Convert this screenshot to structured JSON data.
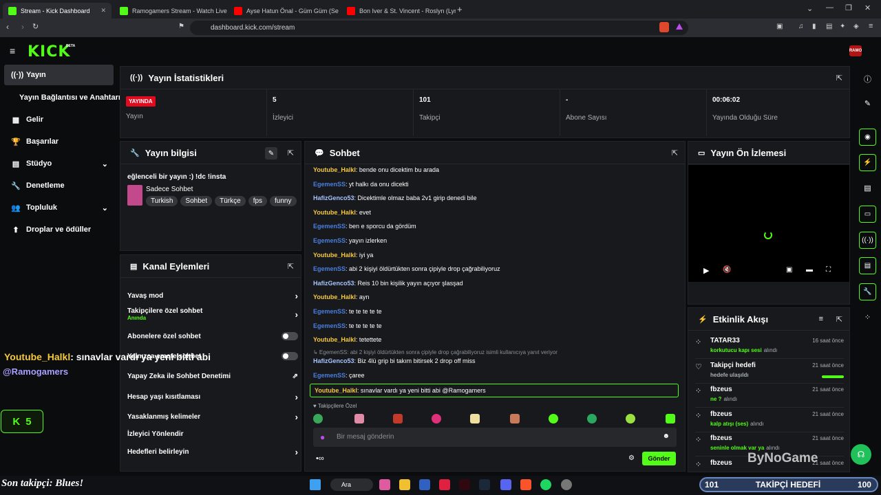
{
  "browser": {
    "tabs": [
      {
        "label": "Stream - Kick Dashboard",
        "color": "#53fc18"
      },
      {
        "label": "Ramogamers Stream - Watch Live on",
        "color": "#53fc18"
      },
      {
        "label": "Ayse Hatun Önal - Güm Güm (Se",
        "color": "#ff0000"
      },
      {
        "label": "Bon Iver & St. Vincent - Roslyn (Lyrics",
        "color": "#ff0000"
      }
    ],
    "url": "dashboard.kick.com/stream",
    "new_tab": "+"
  },
  "app": {
    "logo": "KICK",
    "logo_sup": "BETA",
    "brand": "RAMO"
  },
  "sidebar": {
    "items": [
      {
        "label": "Yayın",
        "icon": "((·))",
        "active": true
      },
      {
        "label": "Yayın Bağlantısı ve Anahtarı",
        "icon": "",
        "active": false
      },
      {
        "label": "Gelir",
        "icon": "▦",
        "active": false
      },
      {
        "label": "Başarılar",
        "icon": "🏆",
        "active": false
      },
      {
        "label": "Stüdyo",
        "icon": "▤",
        "active": false,
        "chevron": "⌄"
      },
      {
        "label": "Denetleme",
        "icon": "🔧",
        "active": false
      },
      {
        "label": "Topluluk",
        "icon": "👥",
        "active": false,
        "chevron": "⌄"
      },
      {
        "label": "Droplar ve ödüller",
        "icon": "⬆",
        "active": false
      }
    ]
  },
  "stats": {
    "title": "Yayın İstatistikleri",
    "cells": [
      {
        "value": "YAYINDA",
        "label": "Yayın"
      },
      {
        "value": "5",
        "label": "İzleyici"
      },
      {
        "value": "101",
        "label": "Takipçi"
      },
      {
        "value": "-",
        "label": "Abone Sayısı"
      },
      {
        "value": "00:06:02",
        "label": "Yayında Olduğu Süre"
      }
    ]
  },
  "info": {
    "title": "Yayın bilgisi",
    "stream_title": "eğlenceli bir yayın :) !dc !insta",
    "category": "Sadece Sohbet",
    "tags": [
      "Turkish",
      "Sohbet",
      "Türkçe",
      "fps",
      "funny"
    ]
  },
  "actions": {
    "title": "Kanal Eylemleri",
    "items": [
      {
        "label": "Yavaş mod",
        "type": "arrow"
      },
      {
        "label": "Takipçilere özel sohbet",
        "sub": "Anında",
        "type": "arrow"
      },
      {
        "label": "Abonelere özel sohbet",
        "type": "toggle"
      },
      {
        "label": "Yalnızca emote sohbet",
        "type": "toggle"
      },
      {
        "label": "Yapay Zeka ile Sohbet Denetimi",
        "type": "link"
      },
      {
        "label": "Hesap yaşı kısıtlaması",
        "type": "arrow"
      },
      {
        "label": "Yasaklanmış kelimeler",
        "type": "arrow"
      },
      {
        "label": "İzleyici Yönlendir",
        "type": "none"
      },
      {
        "label": "Hedefleri belirleyin",
        "type": "arrow"
      }
    ]
  },
  "chat": {
    "title": "Sohbet",
    "messages": [
      {
        "user": "Youtube_Halkl",
        "color": "#f5c842",
        "text": "bende onu dicektim bu arada"
      },
      {
        "user": "EgemenSS",
        "color": "#4a7fe0",
        "text": "yt halkı da onu dicekti"
      },
      {
        "user": "HafizGenco53",
        "color": "#a8c4ff",
        "text": "Dicektimle olmaz baba 2v1 girip denedi bile"
      },
      {
        "user": "Youtube_Halkl",
        "color": "#f5c842",
        "text": "evet"
      },
      {
        "user": "EgemenSS",
        "color": "#4a7fe0",
        "text": "ben e sporcu da gördüm"
      },
      {
        "user": "EgemenSS",
        "color": "#4a7fe0",
        "text": "yayın izlerken"
      },
      {
        "user": "Youtube_Halkl",
        "color": "#f5c842",
        "text": "iyi ya"
      },
      {
        "user": "EgemenSS",
        "color": "#4a7fe0",
        "text": "abi 2 kişiyi öldürtükten sonra çipiyle drop çağrabiliyoruz"
      },
      {
        "user": "HafizGenco53",
        "color": "#a8c4ff",
        "text": "Reis 10 bin kişilik yayın açıyor şlasşad"
      },
      {
        "user": "Youtube_Halkl",
        "color": "#f5c842",
        "text": "ayn"
      },
      {
        "user": "EgemenSS",
        "color": "#4a7fe0",
        "text": "te te te te te"
      },
      {
        "user": "EgemenSS",
        "color": "#4a7fe0",
        "text": "te te te te te"
      },
      {
        "user": "Youtube_Halkl",
        "color": "#f5c842",
        "text": "tetettete"
      }
    ],
    "reply_note": "↳ EgemenSS: abi 2 kişiyi öldürtükten sonra çipiyle drop çağrabiliyoruz isimli kullanıcıya yanıt veriyor",
    "reply_msg": {
      "user": "HafizGenco53",
      "text": "Biz 4lü grip bi takım bitirsek 2 drop off miss"
    },
    "msg2": {
      "user": "EgemenSS",
      "text": "çaree"
    },
    "highlight": {
      "user": "Youtube_Halkl",
      "text": "sınavlar vardı ya yeni bitti abi @Ramogamers"
    },
    "followers_only": "♥ Takipçilere Özel",
    "placeholder": "Bir mesaj gönderin",
    "send": "Gönder"
  },
  "preview": {
    "title": "Yayın Ön İzlemesi"
  },
  "activity": {
    "title": "Etkinlik Akışı",
    "items": [
      {
        "user": "TATAR33",
        "event": "korkutucu kapı sesi",
        "suffix": "alındı",
        "time": "16 saat önce"
      },
      {
        "user": "Takipçi hedefi",
        "event": "hedefe ulaşıldı",
        "suffix": "",
        "time": "21 saat önce"
      },
      {
        "user": "fbzeus",
        "event": "ne ?",
        "suffix": "alındı",
        "time": "21 saat önce"
      },
      {
        "user": "fbzeus",
        "event": "kalp atışı (ses)",
        "suffix": "alındı",
        "time": "21 saat önce"
      },
      {
        "user": "fbzeus",
        "event": "seninle olmak var ya",
        "suffix": "alındı",
        "time": "21 saat önce"
      },
      {
        "user": "fbzeus",
        "event": "",
        "suffix": "",
        "time": "21 saat önce"
      }
    ]
  },
  "overlay": {
    "user": "Youtube_Halkl",
    "text": ": sınavlar vardı ya yeni bitti abi",
    "mention": "@Ramogamers",
    "kick_count": "5",
    "last_follower": "Son takipçi: Blues!",
    "goal_left": "101",
    "goal_label": "TAKİPÇİ HEDEFİ",
    "goal_right": "100",
    "watermark": "ByNoGame"
  },
  "taskbar": {
    "search": "Ara"
  }
}
